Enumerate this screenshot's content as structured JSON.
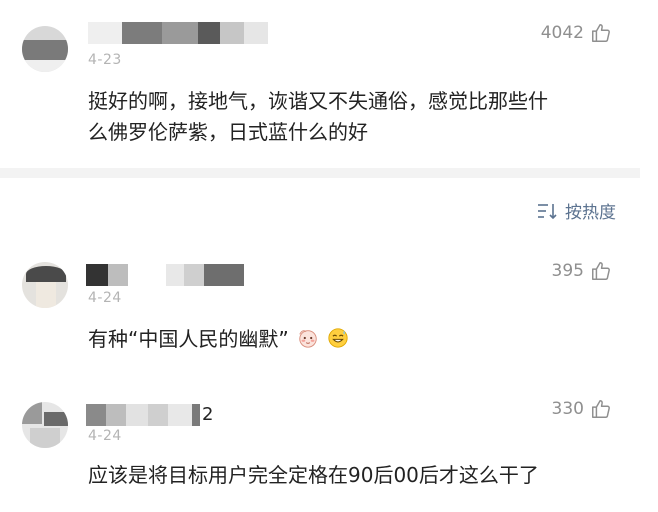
{
  "comments": [
    {
      "date": "4-23",
      "likes": "4042",
      "text": "挺好的啊，接地气，诙谐又不失通俗，感觉比那些什么佛罗伦萨紫，日式蓝什么的好",
      "line1": "挺好的啊，接地气，诙谐又不失通俗，感觉比那些什",
      "line2": "么佛罗伦萨紫，日式蓝什么的好"
    },
    {
      "date": "4-24",
      "likes": "395",
      "text": "有种“中国人民的幽默”"
    },
    {
      "date": "4-24",
      "name_suffix": "2",
      "likes": "330",
      "text": "应该是将目标用户完全定格在90后00后才这么干了"
    }
  ],
  "sort": {
    "label": "按热度",
    "icon": "sort-icon"
  },
  "icons": {
    "like": "thumbs-up-icon",
    "emoji_1": "blushing-emoji-icon",
    "emoji_2": "grinning-sweat-emoji-icon"
  },
  "colors": {
    "like_count": "#8f8f8f",
    "sort_accent": "#5c7390",
    "date": "#b4b4b4",
    "divider": "#f3f3f3"
  }
}
